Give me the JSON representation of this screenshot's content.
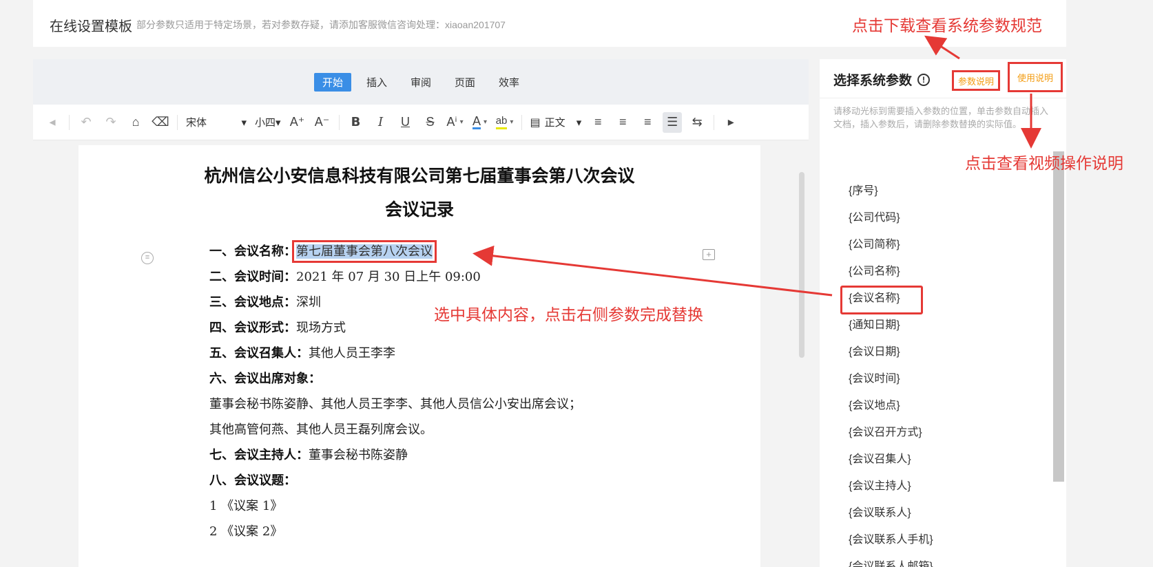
{
  "header": {
    "title": "在线设置模板",
    "hint": "部分参数只适用于特定场景，若对参数存疑，请添加客服微信咨询处理：xiaoan201707"
  },
  "tabs": [
    "开始",
    "插入",
    "审阅",
    "页面",
    "效率"
  ],
  "toolbar": {
    "font": "宋体",
    "size": "小四",
    "style": "正文",
    "font_color_label": "A",
    "highlight_label": "ab"
  },
  "document": {
    "title_line1": "杭州信公小安信息科技有限公司第七届董事会第八次会议",
    "title_line2": "会议记录",
    "lines": [
      {
        "label": "一、会议名称：",
        "value": "第七届董事会第八次会议"
      },
      {
        "label": "二、会议时间：",
        "value": "2021 年 07 月 30 日上午 09:00"
      },
      {
        "label": "三、会议地点：",
        "value": "深圳"
      },
      {
        "label": "四、会议形式：",
        "value": "现场方式"
      },
      {
        "label": "五、会议召集人：",
        "value": "其他人员王李李"
      },
      {
        "label": "六、会议出席对象：",
        "value": ""
      },
      {
        "label": "",
        "value": "董事会秘书陈姿静、其他人员王李李、其他人员信公小安出席会议；"
      },
      {
        "label": "",
        "value": "其他高管何燕、其他人员王磊列席会议。"
      },
      {
        "label": "七、会议主持人：",
        "value": "董事会秘书陈姿静"
      },
      {
        "label": "八、会议议题：",
        "value": ""
      },
      {
        "label": "",
        "value": "1 《议案 1》"
      },
      {
        "label": "",
        "value": "2 《议案 2》"
      }
    ]
  },
  "sidebar": {
    "title": "选择系统参数",
    "param_doc_button": "参数说明",
    "usage_button": "使用说明",
    "description": "请移动光标到需要插入参数的位置，单击参数自动插入文档，插入参数后，请删除参数替换的实际值。",
    "params": [
      "{序号}",
      "{公司代码}",
      "{公司简称}",
      "{公司名称}",
      "{会议名称}",
      "{通知日期}",
      "{会议日期}",
      "{会议时间}",
      "{会议地点}",
      "{会议召开方式}",
      "{会议召集人}",
      "{会议主持人}",
      "{会议联系人}",
      "{会议联系人手机}",
      "{会议联系人邮箱}"
    ]
  },
  "annotations": {
    "download_tip": "点击下载查看系统参数规范",
    "video_tip": "点击查看视频操作说明",
    "replace_tip": "选中具体内容，点击右侧参数完成替换"
  }
}
